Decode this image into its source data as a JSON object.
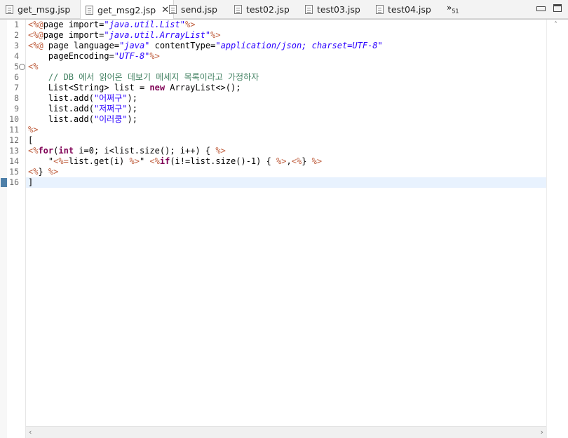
{
  "tabs": [
    {
      "label": "get_msg.jsp",
      "active": false
    },
    {
      "label": "get_msg2.jsp",
      "active": true
    },
    {
      "label": "send.jsp",
      "active": false
    },
    {
      "label": "test02.jsp",
      "active": false
    },
    {
      "label": "test03.jsp",
      "active": false
    },
    {
      "label": "test04.jsp",
      "active": false
    }
  ],
  "tab_close_glyph": "✕",
  "overflow": {
    "glyph": "»",
    "count": "51"
  },
  "editor": {
    "line_numbers": [
      "1",
      "2",
      "3",
      "4",
      "5",
      "6",
      "7",
      "8",
      "9",
      "10",
      "11",
      "12",
      "13",
      "14",
      "15",
      "16"
    ],
    "fold_marker": "⊖",
    "current_line": "16",
    "lines": [
      [
        {
          "t": "<%@",
          "c": "tag"
        },
        {
          "t": "page import=",
          "c": "plain"
        },
        {
          "t": "\"java.util.List\"",
          "c": "stri"
        },
        {
          "t": "%>",
          "c": "tag"
        }
      ],
      [
        {
          "t": "<%@",
          "c": "tag"
        },
        {
          "t": "page import=",
          "c": "plain"
        },
        {
          "t": "\"java.util.ArrayList\"",
          "c": "stri"
        },
        {
          "t": "%>",
          "c": "tag"
        }
      ],
      [
        {
          "t": "<%@",
          "c": "tag"
        },
        {
          "t": " page language=",
          "c": "plain"
        },
        {
          "t": "\"java\"",
          "c": "stri"
        },
        {
          "t": " contentType=",
          "c": "plain"
        },
        {
          "t": "\"application/json; charset=UTF-8\"",
          "c": "stri"
        }
      ],
      [
        {
          "t": "    pageEncoding=",
          "c": "plain"
        },
        {
          "t": "\"UTF-8\"",
          "c": "stri"
        },
        {
          "t": "%>",
          "c": "tag"
        }
      ],
      [
        {
          "t": "<%",
          "c": "tag"
        }
      ],
      [
        {
          "t": "    // DB 에서 읽어온 데보기 메세지 목록이라고 가정하자",
          "c": "cmt"
        }
      ],
      [
        {
          "t": "    List<String> list = ",
          "c": "plain"
        },
        {
          "t": "new",
          "c": "kw"
        },
        {
          "t": " ArrayList<>();",
          "c": "plain"
        }
      ],
      [
        {
          "t": "    list.add(",
          "c": "plain"
        },
        {
          "t": "\"어쩌구\"",
          "c": "str"
        },
        {
          "t": ");",
          "c": "plain"
        }
      ],
      [
        {
          "t": "    list.add(",
          "c": "plain"
        },
        {
          "t": "\"저쩌구\"",
          "c": "str"
        },
        {
          "t": ");",
          "c": "plain"
        }
      ],
      [
        {
          "t": "    list.add(",
          "c": "plain"
        },
        {
          "t": "\"이러쿵\"",
          "c": "str"
        },
        {
          "t": ");",
          "c": "plain"
        }
      ],
      [
        {
          "t": "%>",
          "c": "tag"
        }
      ],
      [
        {
          "t": "[",
          "c": "plain"
        }
      ],
      [
        {
          "t": "<%",
          "c": "tag"
        },
        {
          "t": "for",
          "c": "kw"
        },
        {
          "t": "(",
          "c": "plain"
        },
        {
          "t": "int",
          "c": "kw"
        },
        {
          "t": " i=0; i<list.size(); i++) { ",
          "c": "plain"
        },
        {
          "t": "%>",
          "c": "tag"
        }
      ],
      [
        {
          "t": "    \"",
          "c": "plain"
        },
        {
          "t": "<%=",
          "c": "tag"
        },
        {
          "t": "list.get(i) ",
          "c": "plain"
        },
        {
          "t": "%>",
          "c": "tag"
        },
        {
          "t": "\" ",
          "c": "plain"
        },
        {
          "t": "<%",
          "c": "tag"
        },
        {
          "t": "if",
          "c": "kw"
        },
        {
          "t": "(i!=list.size()-1) { ",
          "c": "plain"
        },
        {
          "t": "%>",
          "c": "tag"
        },
        {
          "t": ",",
          "c": "plain"
        },
        {
          "t": "<%",
          "c": "tag"
        },
        {
          "t": "} ",
          "c": "plain"
        },
        {
          "t": "%>",
          "c": "tag"
        }
      ],
      [
        {
          "t": "<%",
          "c": "tag"
        },
        {
          "t": "} ",
          "c": "plain"
        },
        {
          "t": "%>",
          "c": "tag"
        }
      ],
      [
        {
          "t": "]",
          "c": "plain"
        }
      ]
    ]
  },
  "scrollbar": {
    "up": "˄",
    "down": "˅",
    "left": "‹",
    "right": "›"
  }
}
